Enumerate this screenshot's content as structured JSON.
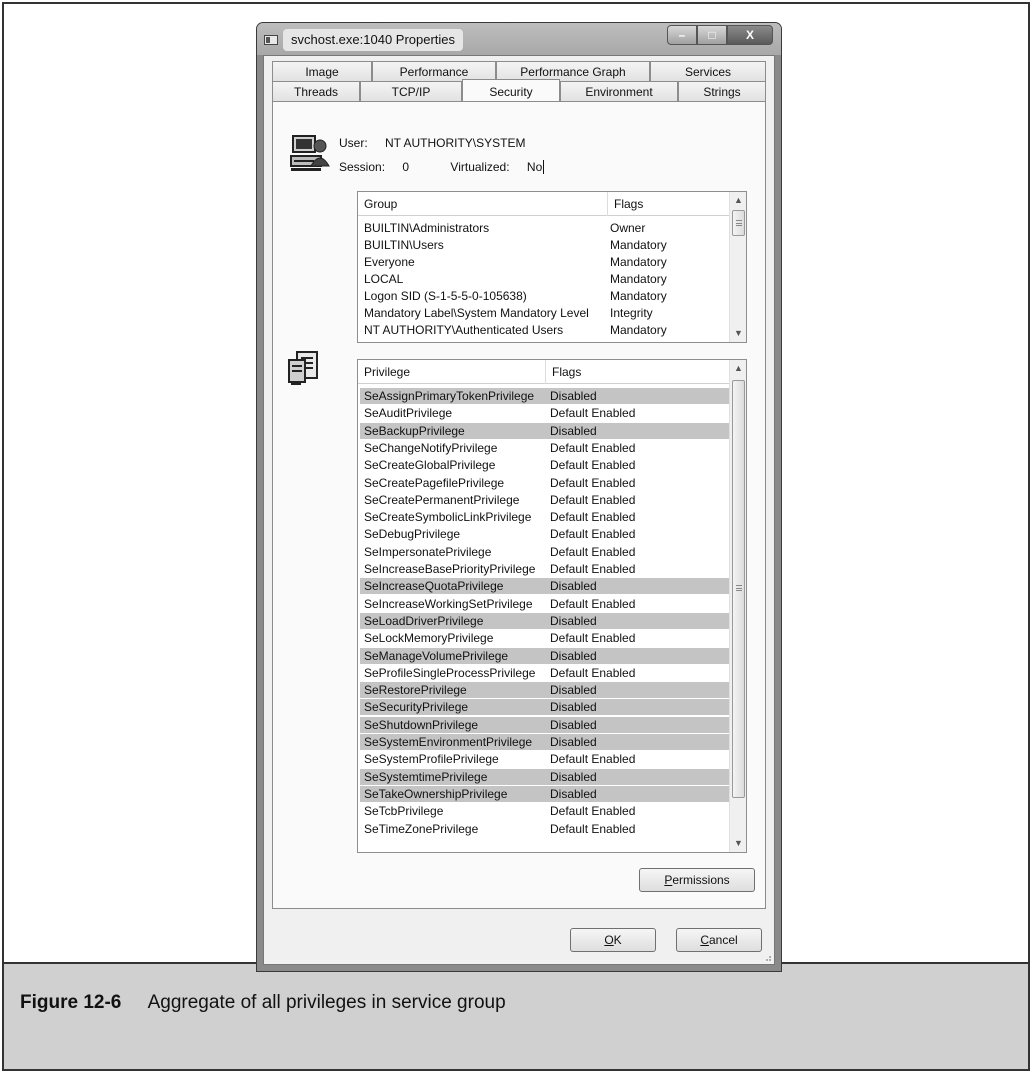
{
  "window": {
    "title": "svchost.exe:1040 Properties",
    "minimize_glyph": "–",
    "maximize_glyph": "□",
    "close_glyph": "X"
  },
  "tabs": {
    "row1": [
      "Image",
      "Performance",
      "Performance Graph",
      "Services"
    ],
    "row2": [
      "Threads",
      "TCP/IP",
      "Security",
      "Environment",
      "Strings"
    ],
    "active": "Security"
  },
  "security": {
    "user_label": "User:",
    "user_value": "NT AUTHORITY\\SYSTEM",
    "session_label": "Session:",
    "session_value": "0",
    "virtualized_label": "Virtualized:",
    "virtualized_value": "No"
  },
  "groups": {
    "columns": [
      "Group",
      "Flags"
    ],
    "rows": [
      {
        "name": "BUILTIN\\Administrators",
        "flags": "Owner"
      },
      {
        "name": "BUILTIN\\Users",
        "flags": "Mandatory"
      },
      {
        "name": "Everyone",
        "flags": "Mandatory"
      },
      {
        "name": "LOCAL",
        "flags": "Mandatory"
      },
      {
        "name": "Logon SID (S-1-5-5-0-105638)",
        "flags": "Mandatory"
      },
      {
        "name": "Mandatory Label\\System Mandatory Level",
        "flags": "Integrity"
      },
      {
        "name": "NT AUTHORITY\\Authenticated Users",
        "flags": "Mandatory"
      }
    ]
  },
  "privileges": {
    "columns": [
      "Privilege",
      "Flags"
    ],
    "rows": [
      {
        "name": "SeAssignPrimaryTokenPrivilege",
        "flags": "Disabled"
      },
      {
        "name": "SeAuditPrivilege",
        "flags": "Default Enabled"
      },
      {
        "name": "SeBackupPrivilege",
        "flags": "Disabled"
      },
      {
        "name": "SeChangeNotifyPrivilege",
        "flags": "Default Enabled"
      },
      {
        "name": "SeCreateGlobalPrivilege",
        "flags": "Default Enabled"
      },
      {
        "name": "SeCreatePagefilePrivilege",
        "flags": "Default Enabled"
      },
      {
        "name": "SeCreatePermanentPrivilege",
        "flags": "Default Enabled"
      },
      {
        "name": "SeCreateSymbolicLinkPrivilege",
        "flags": "Default Enabled"
      },
      {
        "name": "SeDebugPrivilege",
        "flags": "Default Enabled"
      },
      {
        "name": "SeImpersonatePrivilege",
        "flags": "Default Enabled"
      },
      {
        "name": "SeIncreaseBasePriorityPrivilege",
        "flags": "Default Enabled"
      },
      {
        "name": "SeIncreaseQuotaPrivilege",
        "flags": "Disabled"
      },
      {
        "name": "SeIncreaseWorkingSetPrivilege",
        "flags": "Default Enabled"
      },
      {
        "name": "SeLoadDriverPrivilege",
        "flags": "Disabled"
      },
      {
        "name": "SeLockMemoryPrivilege",
        "flags": "Default Enabled"
      },
      {
        "name": "SeManageVolumePrivilege",
        "flags": "Disabled"
      },
      {
        "name": "SeProfileSingleProcessPrivilege",
        "flags": "Default Enabled"
      },
      {
        "name": "SeRestorePrivilege",
        "flags": "Disabled"
      },
      {
        "name": "SeSecurityPrivilege",
        "flags": "Disabled"
      },
      {
        "name": "SeShutdownPrivilege",
        "flags": "Disabled"
      },
      {
        "name": "SeSystemEnvironmentPrivilege",
        "flags": "Disabled"
      },
      {
        "name": "SeSystemProfilePrivilege",
        "flags": "Default Enabled"
      },
      {
        "name": "SeSystemtimePrivilege",
        "flags": "Disabled"
      },
      {
        "name": "SeTakeOwnershipPrivilege",
        "flags": "Disabled"
      },
      {
        "name": "SeTcbPrivilege",
        "flags": "Default Enabled"
      },
      {
        "name": "SeTimeZonePrivilege",
        "flags": "Default Enabled"
      }
    ]
  },
  "buttons": {
    "permissions_mnemonic": "P",
    "permissions_rest": "ermissions",
    "ok_mnemonic": "O",
    "ok_rest": "K",
    "cancel_mnemonic": "C",
    "cancel_rest": "ancel"
  },
  "caption": {
    "number": "Figure 12-6",
    "text": "Aggregate of all privileges in service group"
  },
  "colors": {
    "disabled_row": "#c4c4c4",
    "caption_bar": "#d0d0d0"
  }
}
